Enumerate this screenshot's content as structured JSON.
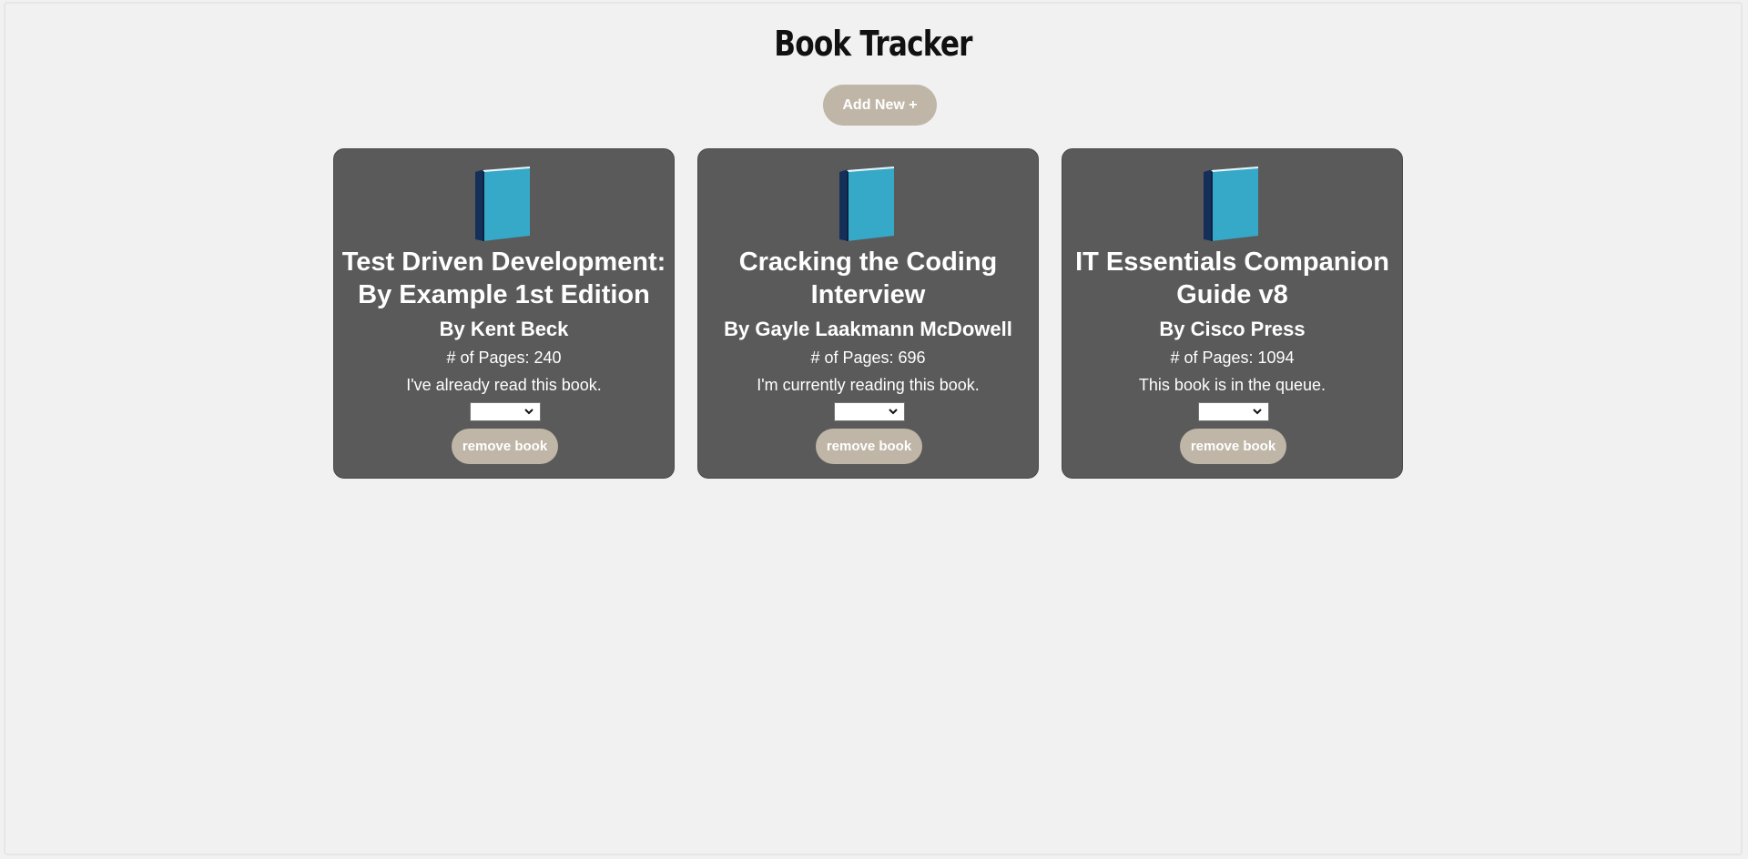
{
  "app": {
    "title": "Book Tracker",
    "add_button_label": "Add New +"
  },
  "colors": {
    "background": "#f1f1f1",
    "card": "#5a5a5a",
    "button": "#bfb6a7",
    "book_cover": "#36a9c9",
    "book_spine": "#14305a"
  },
  "books": [
    {
      "icon": "book-icon",
      "title": "Test Driven Development: By Example 1st Edition",
      "author": "By Kent Beck",
      "pages": "# of Pages: 240",
      "status": "I've already read this book.",
      "select_value": "",
      "remove_label": "remove book"
    },
    {
      "icon": "book-icon",
      "title": "Cracking the Coding Interview",
      "author": "By Gayle Laakmann McDowell",
      "pages": "# of Pages: 696",
      "status": "I'm currently reading this book.",
      "select_value": "",
      "remove_label": "remove book"
    },
    {
      "icon": "book-icon",
      "title": "IT Essentials Companion Guide v8",
      "author": "By Cisco Press",
      "pages": "# of Pages: 1094",
      "status": "This book is in the queue.",
      "select_value": "",
      "remove_label": "remove book"
    }
  ]
}
